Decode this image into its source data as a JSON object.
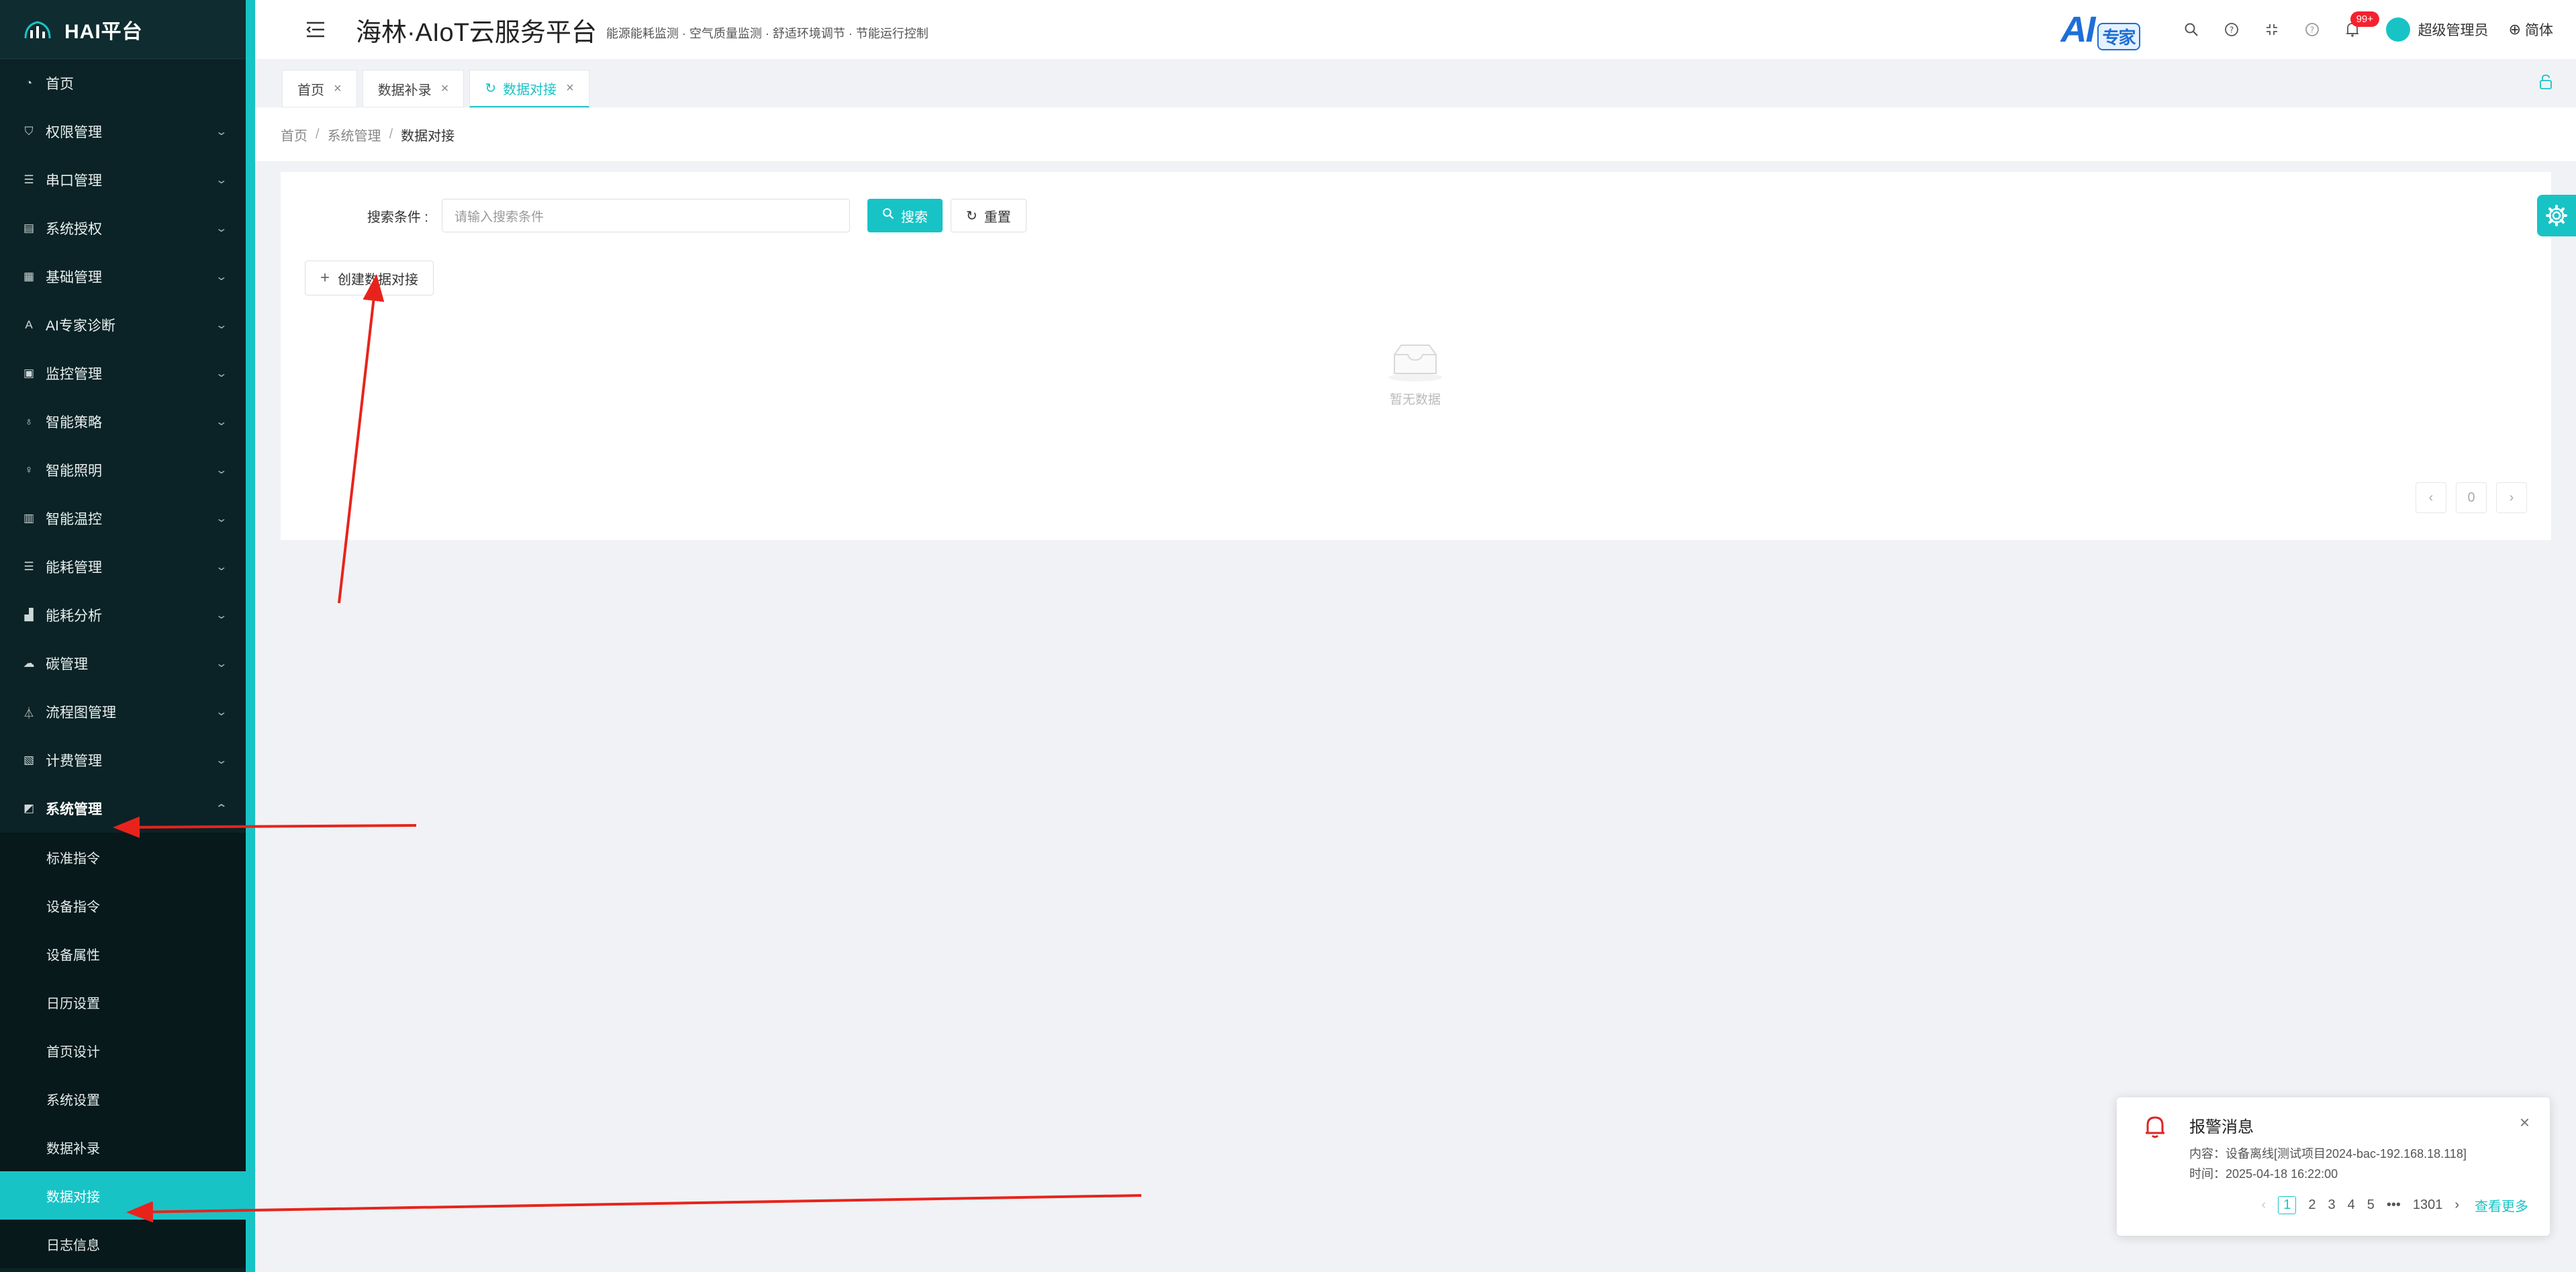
{
  "sidebar": {
    "logo_text": "HAI平台",
    "menu": [
      {
        "label": "首页",
        "icon": "dashboard-icon",
        "has_children": false
      },
      {
        "label": "权限管理",
        "icon": "shield-icon",
        "has_children": true
      },
      {
        "label": "串口管理",
        "icon": "sliders-icon",
        "has_children": true
      },
      {
        "label": "系统授权",
        "icon": "license-icon",
        "has_children": true
      },
      {
        "label": "基础管理",
        "icon": "grid-icon",
        "has_children": true
      },
      {
        "label": "AI专家诊断",
        "icon": "ai-icon",
        "has_children": true
      },
      {
        "label": "监控管理",
        "icon": "monitor-icon",
        "has_children": true
      },
      {
        "label": "智能策略",
        "icon": "bulb-icon",
        "has_children": true
      },
      {
        "label": "智能照明",
        "icon": "light-icon",
        "has_children": true
      },
      {
        "label": "智能温控",
        "icon": "thermostat-icon",
        "has_children": true
      },
      {
        "label": "能耗管理",
        "icon": "sliders-icon",
        "has_children": true
      },
      {
        "label": "能耗分析",
        "icon": "bar-chart-icon",
        "has_children": true
      },
      {
        "label": "碳管理",
        "icon": "cloud-icon",
        "has_children": true
      },
      {
        "label": "流程图管理",
        "icon": "flow-icon",
        "has_children": true
      },
      {
        "label": "计费管理",
        "icon": "billing-icon",
        "has_children": true
      },
      {
        "label": "系统管理",
        "icon": "system-icon",
        "has_children": true,
        "expanded": true
      }
    ],
    "submenu": [
      {
        "label": "标准指令"
      },
      {
        "label": "设备指令"
      },
      {
        "label": "设备属性"
      },
      {
        "label": "日历设置"
      },
      {
        "label": "首页设计"
      },
      {
        "label": "系统设置"
      },
      {
        "label": "数据补录"
      },
      {
        "label": "数据对接",
        "active": true
      },
      {
        "label": "日志信息"
      }
    ]
  },
  "header": {
    "title": "海林·AIoT云服务平台",
    "subtitle": "能源能耗监测 · 空气质量监测 · 舒适环境调节 · 节能运行控制",
    "ai_logo": "AI",
    "ai_logo_tag": "专家",
    "notification_count": "99+",
    "user_name": "超级管理员",
    "language": "简体"
  },
  "tabs": [
    {
      "label": "首页",
      "active": false
    },
    {
      "label": "数据补录",
      "active": false
    },
    {
      "label": "数据对接",
      "active": true
    }
  ],
  "breadcrumb": [
    "首页",
    "系统管理",
    "数据对接"
  ],
  "search": {
    "label": "搜索条件 :",
    "placeholder": "请输入搜索条件",
    "search_button": "搜索",
    "reset_button": "重置"
  },
  "create_button": "创建数据对接",
  "empty_text": "暂无数据",
  "table_pager": {
    "current": "0"
  },
  "alert": {
    "title": "报警消息",
    "content": "内容：设备离线[测试项目2024-bac-192.168.18.118]",
    "time": "时间：2025-04-18 16:22:00",
    "pages": [
      "1",
      "2",
      "3",
      "4",
      "5"
    ],
    "ellipsis": "•••",
    "last_page": "1301",
    "more": "查看更多"
  },
  "colors": {
    "accent": "#18c3c6",
    "sidebar_bg": "#0b2326",
    "annotation_arrow": "#e8231c",
    "alert_bell": "#e02424",
    "ai_logo_blue": "#1d6fd8"
  }
}
